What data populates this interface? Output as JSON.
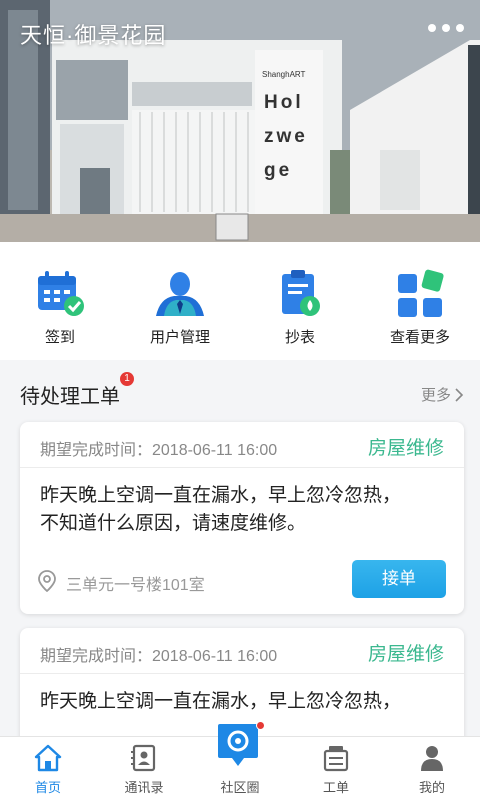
{
  "header": {
    "title": "天恒·御景花园"
  },
  "banner": {
    "sign_line1": "Hol",
    "sign_line2": "zwe",
    "sign_line3": "ge",
    "sign_brand": "ShanghART"
  },
  "quick_actions": [
    {
      "label": "签到",
      "icon": "calendar-check-icon"
    },
    {
      "label": "用户管理",
      "icon": "user-manage-icon"
    },
    {
      "label": "抄表",
      "icon": "meter-read-icon"
    },
    {
      "label": "查看更多",
      "icon": "grid-more-icon"
    }
  ],
  "pending": {
    "title": "待处理工单",
    "badge": "1",
    "more_label": "更多"
  },
  "orders": [
    {
      "time": "期望完成时间：2018-06-11 16:00",
      "type": "房屋维修",
      "desc_line1": "昨天晚上空调一直在漏水，早上忽冷忽热，",
      "desc_line2": "不知道什么原因，请速度维修。",
      "location": "三单元一号楼101室",
      "action_label": "接单"
    },
    {
      "time": "期望完成时间：2018-06-11 16:00",
      "type": "房屋维修",
      "desc_line1": "昨天晚上空调一直在漏水，早上忽冷忽热，",
      "desc_line2": ""
    }
  ],
  "tabs": [
    {
      "label": "首页",
      "icon": "home-icon",
      "active": true
    },
    {
      "label": "通讯录",
      "icon": "contacts-icon",
      "active": false
    },
    {
      "label": "社区圈",
      "icon": "community-icon",
      "active": false
    },
    {
      "label": "工单",
      "icon": "work-order-icon",
      "active": false
    },
    {
      "label": "我的",
      "icon": "profile-icon",
      "active": false
    }
  ],
  "colors": {
    "accent_blue": "#1e88e5",
    "accent_green": "#3bb88f",
    "badge_red": "#e53935"
  }
}
